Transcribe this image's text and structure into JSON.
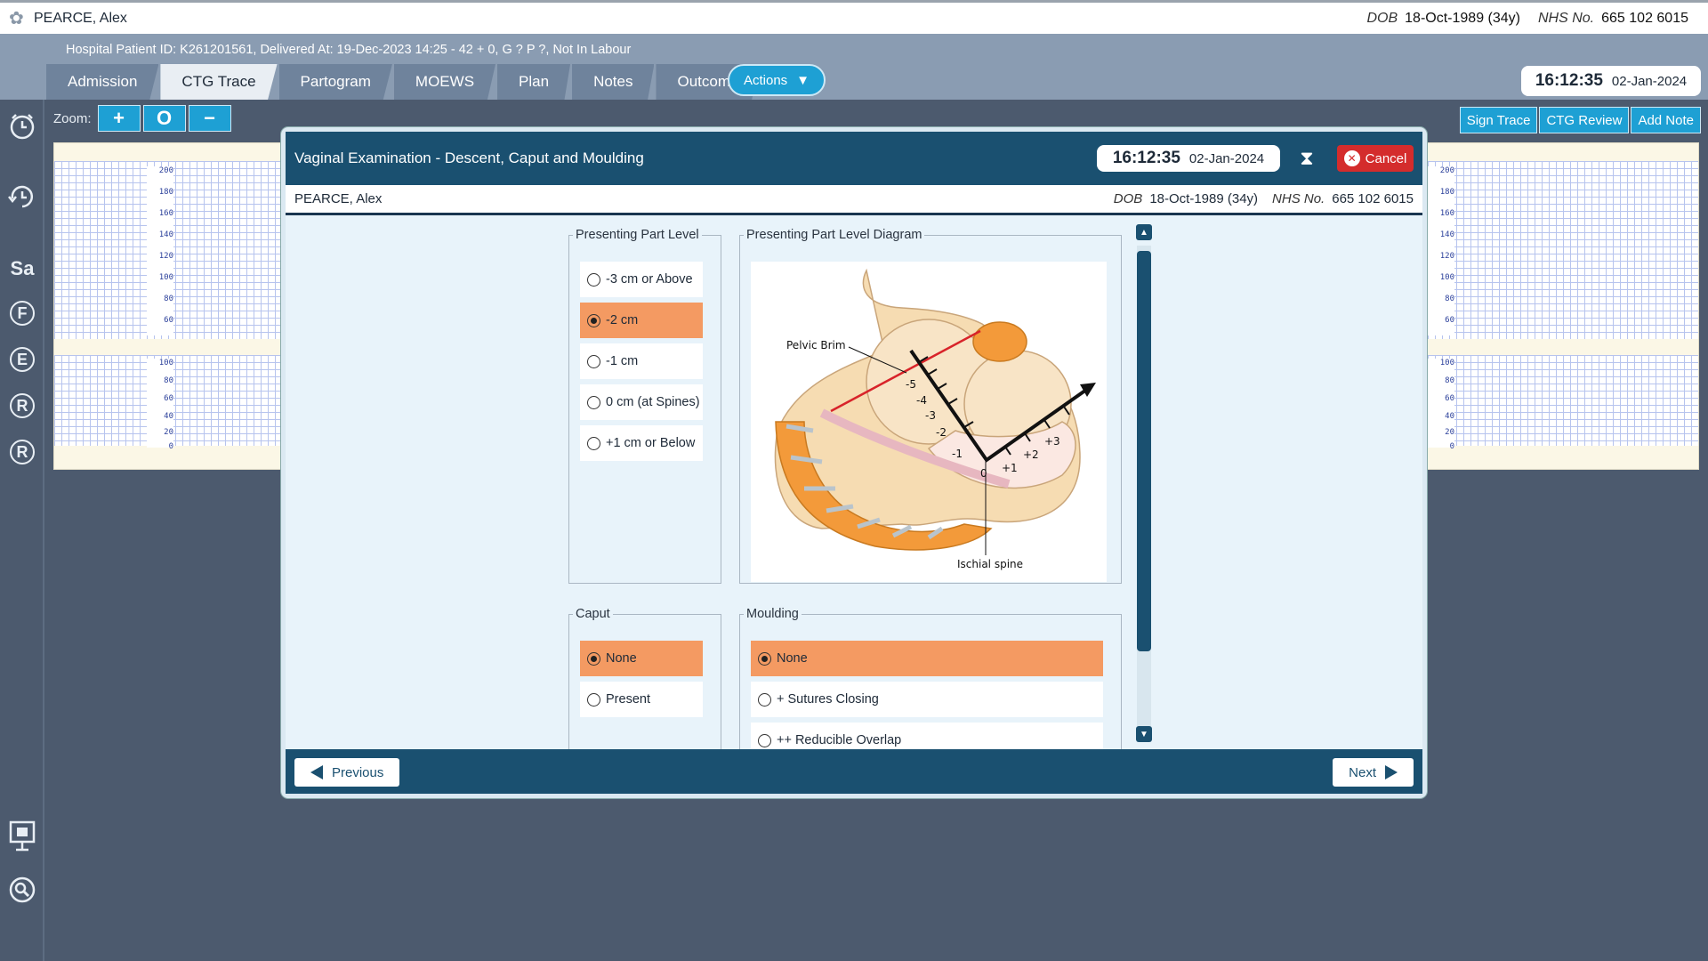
{
  "topbar": {
    "patient_name": "PEARCE, Alex",
    "dob_label": "DOB",
    "dob_value": "18-Oct-1989 (34y)",
    "nhs_label": "NHS No.",
    "nhs_value": "665 102 6015"
  },
  "header": {
    "patient_info": "Hospital Patient ID: K261201561, Delivered At: 19-Dec-2023 14:25 - 42 + 0, G ? P ?,   Not In Labour",
    "tabs": [
      "Admission",
      "CTG Trace",
      "Partogram",
      "MOEWS",
      "Plan",
      "Notes",
      "Outcome"
    ],
    "active_tab": "CTG Trace",
    "actions_label": "Actions",
    "clock_time": "16:12:35",
    "clock_date": "02-Jan-2024"
  },
  "rail": {
    "items": [
      "Sa",
      "F",
      "E",
      "R",
      "R"
    ]
  },
  "main": {
    "zoom_label": "Zoom:",
    "zoom_in": "+",
    "zoom_reset": "O",
    "zoom_out": "−",
    "sign_trace": "Sign Trace",
    "ctg_review": "CTG Review",
    "add_note": "Add Note",
    "fhr_scale": [
      "200",
      "180",
      "160",
      "140",
      "120",
      "100",
      "80",
      "60"
    ],
    "toco_scale": [
      "100",
      "80",
      "60",
      "40",
      "20",
      "0"
    ]
  },
  "modal": {
    "title": "Vaginal Examination - Descent, Caput and Moulding",
    "clock_time": "16:12:35",
    "clock_date": "02-Jan-2024",
    "cancel_label": "Cancel",
    "patient_name": "PEARCE, Alex",
    "dob_label": "DOB",
    "dob_value": "18-Oct-1989 (34y)",
    "nhs_label": "NHS No.",
    "nhs_value": "665 102 6015",
    "level": {
      "legend": "Presenting Part Level",
      "options": [
        "-3 cm or Above",
        "-2 cm",
        "-1 cm",
        "0 cm (at Spines)",
        "+1 cm or Below"
      ],
      "selected": 1
    },
    "diagram": {
      "legend": "Presenting Part Level Diagram",
      "pelvic_brim": "Pelvic Brim",
      "ischial_spine": "Ischial spine",
      "ticks_neg": [
        "-5",
        "-4",
        "-3",
        "-2",
        "-1"
      ],
      "tick_zero": "0",
      "ticks_pos": [
        "+1",
        "+2",
        "+3"
      ]
    },
    "caput": {
      "legend": "Caput",
      "options": [
        "None",
        "Present"
      ],
      "selected": 0
    },
    "moulding": {
      "legend": "Moulding",
      "options": [
        "None",
        "+ Sutures Closing",
        "++ Reducible Overlap"
      ],
      "selected": 0
    },
    "previous_label": "Previous",
    "next_label": "Next"
  },
  "colors": {
    "accent": "#1ea0d4",
    "modal_header": "#1a5070",
    "selected_option": "#f49a62",
    "cancel": "#d42c2c"
  }
}
